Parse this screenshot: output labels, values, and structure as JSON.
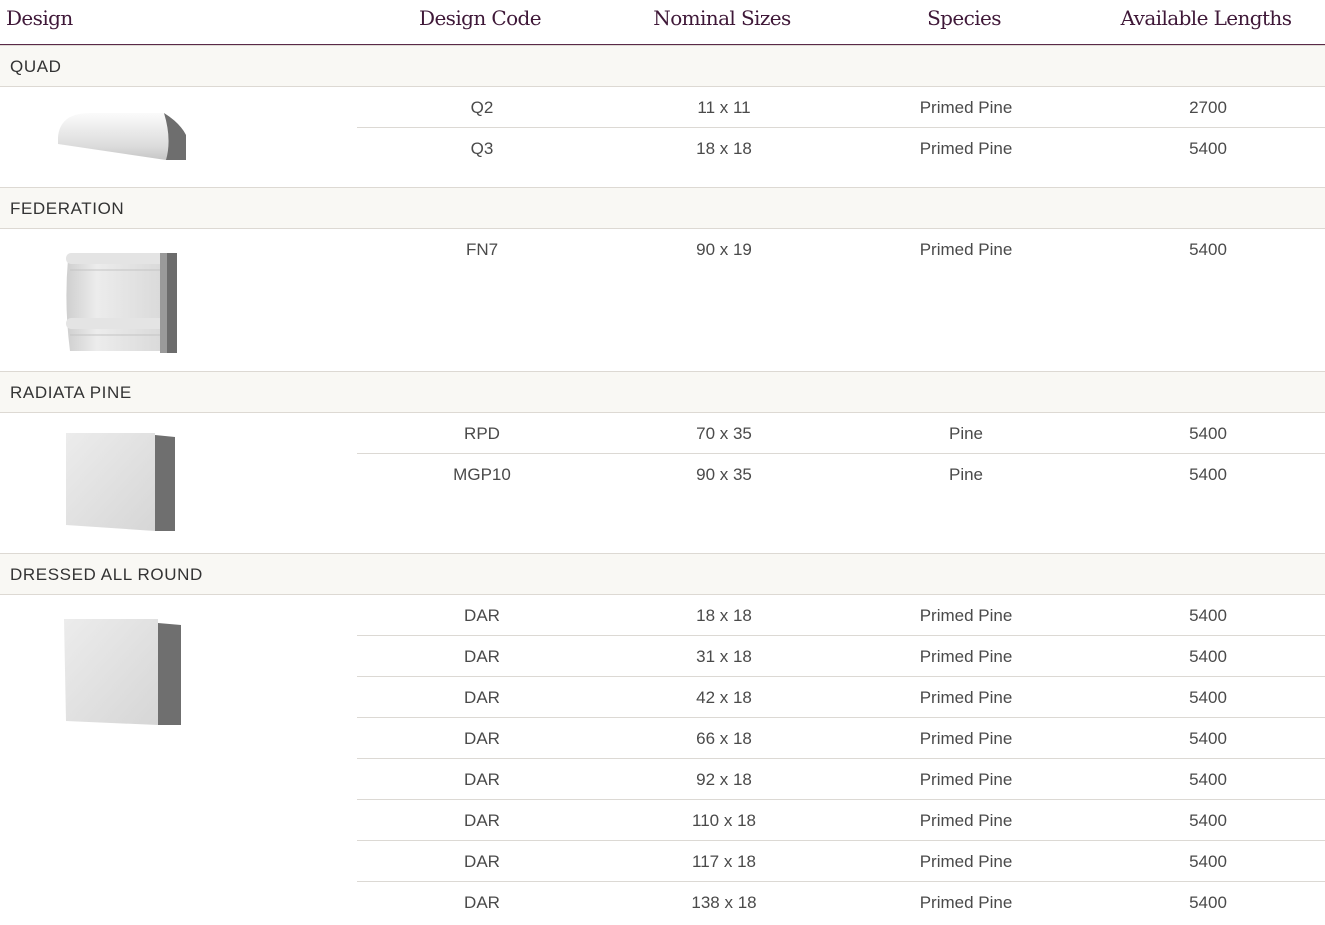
{
  "headers": {
    "design": "Design",
    "code": "Design Code",
    "sizes": "Nominal Sizes",
    "species": "Species",
    "lengths": "Available Lengths"
  },
  "sections": [
    {
      "name": "QUAD",
      "rows": [
        {
          "code": "Q2",
          "size": "11 x 11",
          "species": "Primed Pine",
          "length": "2700"
        },
        {
          "code": "Q3",
          "size": "18 x 18",
          "species": "Primed Pine",
          "length": "5400"
        }
      ]
    },
    {
      "name": "FEDERATION",
      "rows": [
        {
          "code": "FN7",
          "size": "90 x 19",
          "species": "Primed Pine",
          "length": "5400"
        }
      ]
    },
    {
      "name": "RADIATA PINE",
      "rows": [
        {
          "code": "RPD",
          "size": "70 x 35",
          "species": "Pine",
          "length": "5400"
        },
        {
          "code": "MGP10",
          "size": "90 x 35",
          "species": "Pine",
          "length": "5400"
        }
      ]
    },
    {
      "name": "DRESSED ALL ROUND",
      "rows": [
        {
          "code": "DAR",
          "size": "18 x 18",
          "species": "Primed Pine",
          "length": "5400"
        },
        {
          "code": "DAR",
          "size": "31 x 18",
          "species": "Primed Pine",
          "length": "5400"
        },
        {
          "code": "DAR",
          "size": "42 x 18",
          "species": "Primed Pine",
          "length": "5400"
        },
        {
          "code": "DAR",
          "size": "66 x 18",
          "species": "Primed Pine",
          "length": "5400"
        },
        {
          "code": "DAR",
          "size": "92 x 18",
          "species": "Primed Pine",
          "length": "5400"
        },
        {
          "code": "DAR",
          "size": "110 x 18",
          "species": "Primed Pine",
          "length": "5400"
        },
        {
          "code": "DAR",
          "size": "117 x 18",
          "species": "Primed Pine",
          "length": "5400"
        },
        {
          "code": "DAR",
          "size": "138 x 18",
          "species": "Primed Pine",
          "length": "5400"
        }
      ]
    }
  ]
}
